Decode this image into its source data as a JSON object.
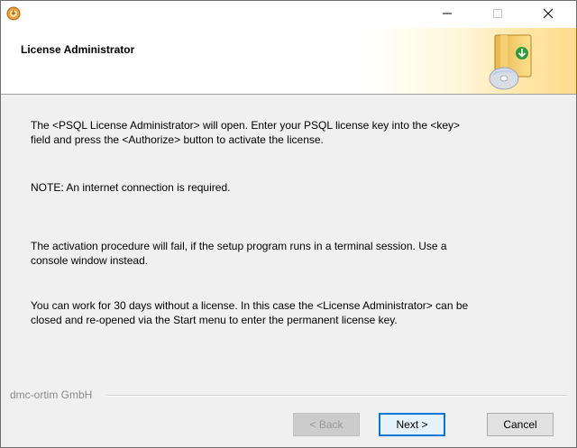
{
  "window": {
    "header_title": "License Administrator",
    "company": "dmc-ortim GmbH"
  },
  "paragraphs": {
    "p1_line1": "The <PSQL License Administrator> will open. Enter your PSQL license key into the <key>",
    "p1_line2": "field and press the <Authorize> button to activate the license.",
    "p2": "NOTE: An internet connection is required.",
    "p3_line1": "The activation procedure will fail, if the setup program runs in a terminal session. Use a",
    "p3_line2": "console window instead.",
    "p4_line1": "You can work for 30 days without a license. In this case the <License Administrator> can be",
    "p4_line2": "closed and re-opened via the Start menu to enter the permanent license key."
  },
  "buttons": {
    "back": "< Back",
    "next": "Next >",
    "cancel": "Cancel"
  },
  "icons": {
    "app": "installer-icon",
    "header_art": "package-disc-icon",
    "minimize": "minimize-icon",
    "maximize": "maximize-icon",
    "close": "close-icon"
  },
  "colors": {
    "accent": "#0078d7",
    "header_glow": "#ffdc8c"
  }
}
